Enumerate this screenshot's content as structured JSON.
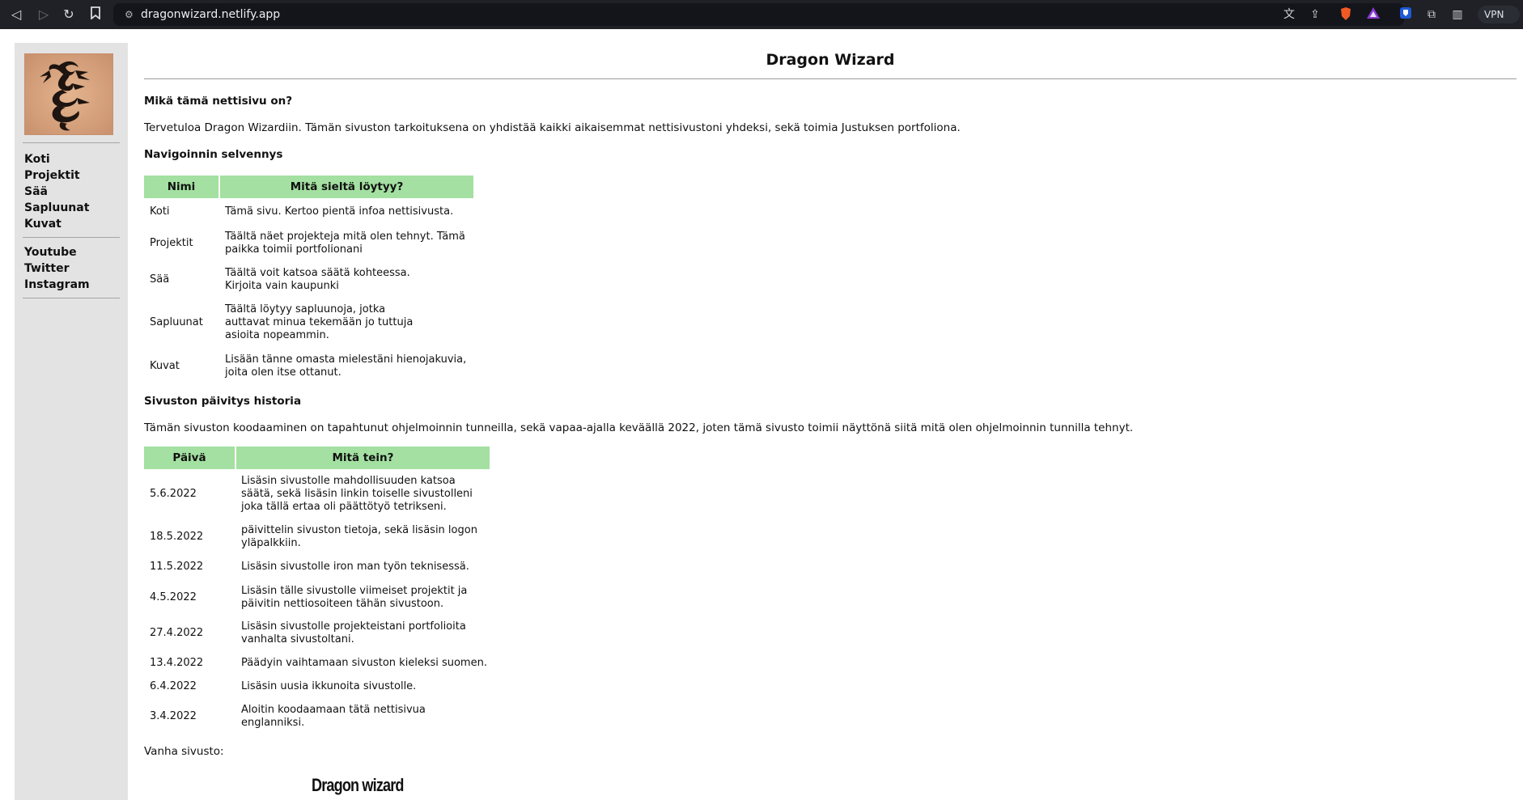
{
  "browser": {
    "url": "dragonwizard.netlify.app",
    "vpn_label": "VPN"
  },
  "sidebar": {
    "nav": [
      {
        "label": "Koti"
      },
      {
        "label": "Projektit"
      },
      {
        "label": "Sää"
      },
      {
        "label": "Sapluunat"
      },
      {
        "label": "Kuvat"
      }
    ],
    "social": [
      {
        "label": "Youtube"
      },
      {
        "label": "Twitter"
      },
      {
        "label": "Instagram"
      }
    ]
  },
  "main": {
    "title": "Dragon Wizard",
    "intro_heading": "Mikä tämä nettisivu on?",
    "intro_text": "Tervetuloa Dragon Wizardiin. Tämän sivuston tarkoituksena on yhdistää kaikki aikaisemmat nettisivustoni yhdeksi, sekä toimia Justuksen portfoliona.",
    "nav_heading": "Navigoinnin selvennys",
    "nav_table": {
      "headers": [
        "Nimi",
        "Mitä sieltä löytyy?"
      ],
      "rows": [
        [
          "Koti",
          "Tämä sivu. Kertoo pientä infoa nettisivusta."
        ],
        [
          "Projektit",
          "Täältä näet projekteja mitä olen tehnyt. Tämä paikka toimii portfolionani"
        ],
        [
          "Sää",
          "Täältä voit katsoa säätä kohteessa. Kirjoita vain kaupunki"
        ],
        [
          "Sapluunat",
          "Täältä löytyy sapluunoja, jotka auttavat minua tekemään jo tuttuja asioita nopeammin."
        ],
        [
          "Kuvat",
          "Lisään tänne omasta mielestäni hienojakuvia, joita olen itse ottanut."
        ]
      ]
    },
    "history_heading": "Sivuston päivitys historia",
    "history_text": "Tämän sivuston koodaaminen on tapahtunut ohjelmoinnin tunneilla, sekä vapaa-ajalla keväällä 2022, joten tämä sivusto toimii näyttönä siitä mitä olen ohjelmoinnin tunnilla tehnyt.",
    "history_table": {
      "headers": [
        "Päivä",
        "Mitä tein?"
      ],
      "rows": [
        [
          "5.6.2022",
          "Lisäsin sivustolle mahdollisuuden katsoa säätä, sekä lisäsin linkin toiselle sivustolleni joka tällä ertaa oli päättötyö tetrikseni."
        ],
        [
          "18.5.2022",
          "päivittelin sivuston tietoja, sekä lisäsin logon yläpalkkiin."
        ],
        [
          "11.5.2022",
          "Lisäsin sivustolle iron man työn teknisessä."
        ],
        [
          "4.5.2022",
          "Lisäsin tälle sivustolle viimeiset projektit ja päivitin nettiosoiteen tähän sivustoon."
        ],
        [
          "27.4.2022",
          "Lisäsin sivustolle projekteistani portfolioita vanhalta sivustoltani."
        ],
        [
          "13.4.2022",
          "Päädyin vaihtamaan sivuston kieleksi suomen."
        ],
        [
          "6.4.2022",
          "Lisäsin uusia ikkunoita sivustolle."
        ],
        [
          "3.4.2022",
          "Aloitin koodaamaan tätä nettisivua englanniksi."
        ]
      ]
    },
    "old_site_label": "Vanha sivusto:",
    "old_site_title": "Dragon wizard"
  }
}
